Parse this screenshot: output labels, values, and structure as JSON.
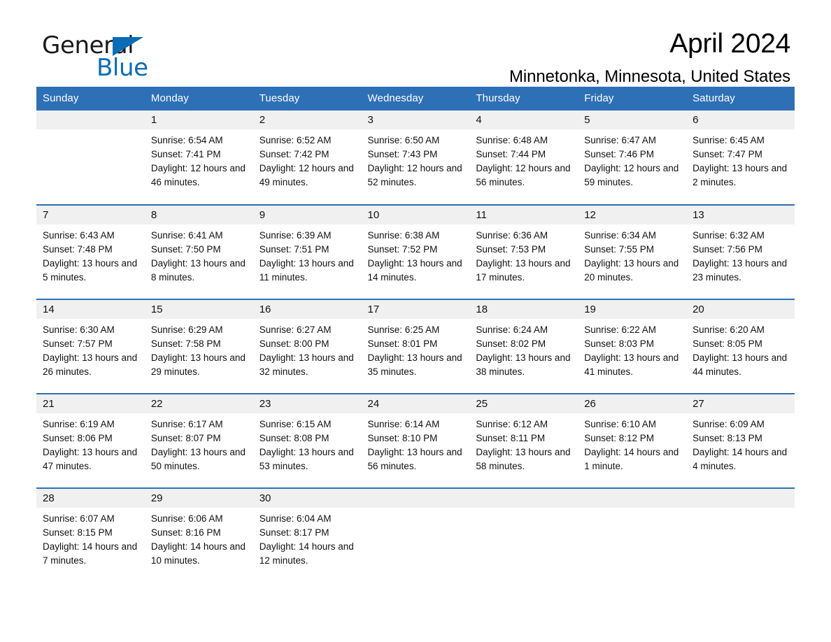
{
  "logo": {
    "word_one": "General",
    "word_two": "Blue",
    "triangle_icon": "triangle-icon",
    "brand_color": "#0a6cb4"
  },
  "header": {
    "month_title": "April 2024",
    "location": "Minnetonka, Minnesota, United States"
  },
  "theme": {
    "header_blue": "#2e70b5",
    "daynum_gray": "#f0f0f0",
    "cell_white": "#ffffff"
  },
  "calendar": {
    "weekday_headers": [
      "Sunday",
      "Monday",
      "Tuesday",
      "Wednesday",
      "Thursday",
      "Friday",
      "Saturday"
    ],
    "labels": {
      "sunrise_prefix": "Sunrise:",
      "sunset_prefix": "Sunset:",
      "daylight_prefix": "Daylight:"
    },
    "weeks": [
      [
        {
          "day": "",
          "sunrise": "",
          "sunset": "",
          "daylight": "",
          "empty": true
        },
        {
          "day": "1",
          "sunrise": "Sunrise: 6:54 AM",
          "sunset": "Sunset: 7:41 PM",
          "daylight": "Daylight: 12 hours and 46 minutes."
        },
        {
          "day": "2",
          "sunrise": "Sunrise: 6:52 AM",
          "sunset": "Sunset: 7:42 PM",
          "daylight": "Daylight: 12 hours and 49 minutes."
        },
        {
          "day": "3",
          "sunrise": "Sunrise: 6:50 AM",
          "sunset": "Sunset: 7:43 PM",
          "daylight": "Daylight: 12 hours and 52 minutes."
        },
        {
          "day": "4",
          "sunrise": "Sunrise: 6:48 AM",
          "sunset": "Sunset: 7:44 PM",
          "daylight": "Daylight: 12 hours and 56 minutes."
        },
        {
          "day": "5",
          "sunrise": "Sunrise: 6:47 AM",
          "sunset": "Sunset: 7:46 PM",
          "daylight": "Daylight: 12 hours and 59 minutes."
        },
        {
          "day": "6",
          "sunrise": "Sunrise: 6:45 AM",
          "sunset": "Sunset: 7:47 PM",
          "daylight": "Daylight: 13 hours and 2 minutes."
        }
      ],
      [
        {
          "day": "7",
          "sunrise": "Sunrise: 6:43 AM",
          "sunset": "Sunset: 7:48 PM",
          "daylight": "Daylight: 13 hours and 5 minutes."
        },
        {
          "day": "8",
          "sunrise": "Sunrise: 6:41 AM",
          "sunset": "Sunset: 7:50 PM",
          "daylight": "Daylight: 13 hours and 8 minutes."
        },
        {
          "day": "9",
          "sunrise": "Sunrise: 6:39 AM",
          "sunset": "Sunset: 7:51 PM",
          "daylight": "Daylight: 13 hours and 11 minutes."
        },
        {
          "day": "10",
          "sunrise": "Sunrise: 6:38 AM",
          "sunset": "Sunset: 7:52 PM",
          "daylight": "Daylight: 13 hours and 14 minutes."
        },
        {
          "day": "11",
          "sunrise": "Sunrise: 6:36 AM",
          "sunset": "Sunset: 7:53 PM",
          "daylight": "Daylight: 13 hours and 17 minutes."
        },
        {
          "day": "12",
          "sunrise": "Sunrise: 6:34 AM",
          "sunset": "Sunset: 7:55 PM",
          "daylight": "Daylight: 13 hours and 20 minutes."
        },
        {
          "day": "13",
          "sunrise": "Sunrise: 6:32 AM",
          "sunset": "Sunset: 7:56 PM",
          "daylight": "Daylight: 13 hours and 23 minutes."
        }
      ],
      [
        {
          "day": "14",
          "sunrise": "Sunrise: 6:30 AM",
          "sunset": "Sunset: 7:57 PM",
          "daylight": "Daylight: 13 hours and 26 minutes."
        },
        {
          "day": "15",
          "sunrise": "Sunrise: 6:29 AM",
          "sunset": "Sunset: 7:58 PM",
          "daylight": "Daylight: 13 hours and 29 minutes."
        },
        {
          "day": "16",
          "sunrise": "Sunrise: 6:27 AM",
          "sunset": "Sunset: 8:00 PM",
          "daylight": "Daylight: 13 hours and 32 minutes."
        },
        {
          "day": "17",
          "sunrise": "Sunrise: 6:25 AM",
          "sunset": "Sunset: 8:01 PM",
          "daylight": "Daylight: 13 hours and 35 minutes."
        },
        {
          "day": "18",
          "sunrise": "Sunrise: 6:24 AM",
          "sunset": "Sunset: 8:02 PM",
          "daylight": "Daylight: 13 hours and 38 minutes."
        },
        {
          "day": "19",
          "sunrise": "Sunrise: 6:22 AM",
          "sunset": "Sunset: 8:03 PM",
          "daylight": "Daylight: 13 hours and 41 minutes."
        },
        {
          "day": "20",
          "sunrise": "Sunrise: 6:20 AM",
          "sunset": "Sunset: 8:05 PM",
          "daylight": "Daylight: 13 hours and 44 minutes."
        }
      ],
      [
        {
          "day": "21",
          "sunrise": "Sunrise: 6:19 AM",
          "sunset": "Sunset: 8:06 PM",
          "daylight": "Daylight: 13 hours and 47 minutes."
        },
        {
          "day": "22",
          "sunrise": "Sunrise: 6:17 AM",
          "sunset": "Sunset: 8:07 PM",
          "daylight": "Daylight: 13 hours and 50 minutes."
        },
        {
          "day": "23",
          "sunrise": "Sunrise: 6:15 AM",
          "sunset": "Sunset: 8:08 PM",
          "daylight": "Daylight: 13 hours and 53 minutes."
        },
        {
          "day": "24",
          "sunrise": "Sunrise: 6:14 AM",
          "sunset": "Sunset: 8:10 PM",
          "daylight": "Daylight: 13 hours and 56 minutes."
        },
        {
          "day": "25",
          "sunrise": "Sunrise: 6:12 AM",
          "sunset": "Sunset: 8:11 PM",
          "daylight": "Daylight: 13 hours and 58 minutes."
        },
        {
          "day": "26",
          "sunrise": "Sunrise: 6:10 AM",
          "sunset": "Sunset: 8:12 PM",
          "daylight": "Daylight: 14 hours and 1 minute."
        },
        {
          "day": "27",
          "sunrise": "Sunrise: 6:09 AM",
          "sunset": "Sunset: 8:13 PM",
          "daylight": "Daylight: 14 hours and 4 minutes."
        }
      ],
      [
        {
          "day": "28",
          "sunrise": "Sunrise: 6:07 AM",
          "sunset": "Sunset: 8:15 PM",
          "daylight": "Daylight: 14 hours and 7 minutes."
        },
        {
          "day": "29",
          "sunrise": "Sunrise: 6:06 AM",
          "sunset": "Sunset: 8:16 PM",
          "daylight": "Daylight: 14 hours and 10 minutes."
        },
        {
          "day": "30",
          "sunrise": "Sunrise: 6:04 AM",
          "sunset": "Sunset: 8:17 PM",
          "daylight": "Daylight: 14 hours and 12 minutes."
        },
        {
          "day": "",
          "sunrise": "",
          "sunset": "",
          "daylight": "",
          "empty": true
        },
        {
          "day": "",
          "sunrise": "",
          "sunset": "",
          "daylight": "",
          "empty": true
        },
        {
          "day": "",
          "sunrise": "",
          "sunset": "",
          "daylight": "",
          "empty": true
        },
        {
          "day": "",
          "sunrise": "",
          "sunset": "",
          "daylight": "",
          "empty": true
        }
      ]
    ]
  }
}
